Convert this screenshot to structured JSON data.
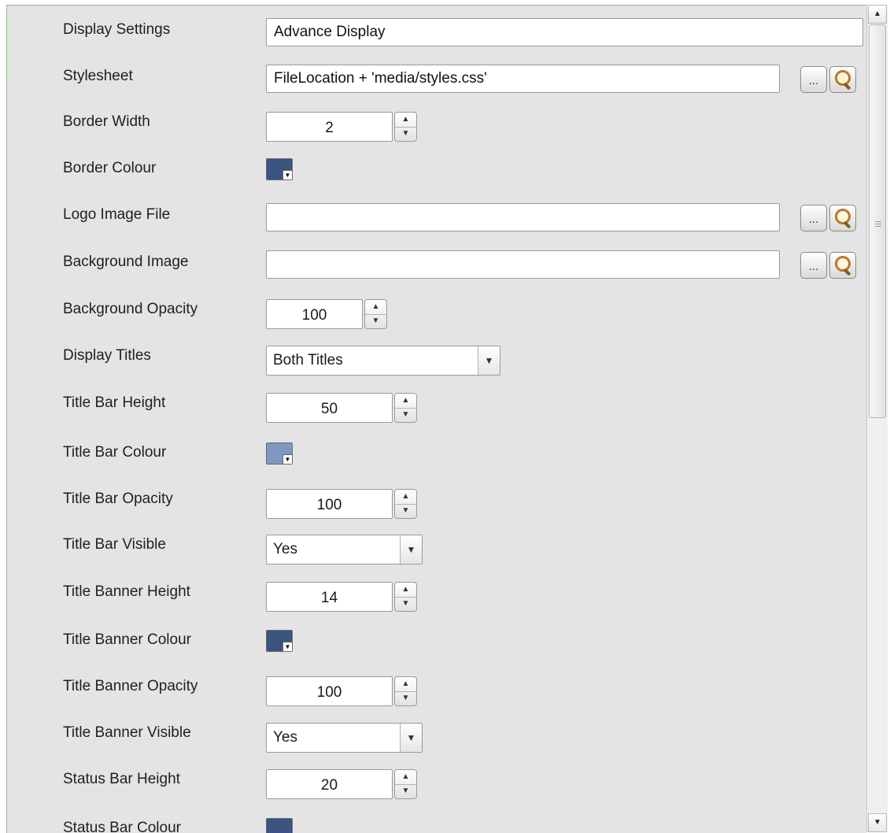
{
  "colors": {
    "panel_bg": "#e4e4e4",
    "border_colour": "#3b5380",
    "title_bar_colour": "#7e98c2",
    "title_banner_colour": "#3b5380",
    "status_bar_colour": "#3b5380"
  },
  "fields": {
    "display_settings": {
      "label": "Display Settings",
      "value": "Advance Display"
    },
    "stylesheet": {
      "label": "Stylesheet",
      "value": "FileLocation + 'media/styles.css'",
      "browse_label": "...",
      "search_icon": "magnifier-icon"
    },
    "border_width": {
      "label": "Border Width",
      "value": "2"
    },
    "border_colour": {
      "label": "Border Colour"
    },
    "logo_image_file": {
      "label": "Logo Image File",
      "value": "",
      "browse_label": "...",
      "search_icon": "magnifier-icon"
    },
    "background_image": {
      "label": "Background Image",
      "value": "",
      "browse_label": "...",
      "search_icon": "magnifier-icon"
    },
    "background_opacity": {
      "label": "Background Opacity",
      "value": "100"
    },
    "display_titles": {
      "label": "Display Titles",
      "value": "Both Titles"
    },
    "title_bar_height": {
      "label": "Title Bar Height",
      "value": "50"
    },
    "title_bar_colour": {
      "label": "Title Bar Colour"
    },
    "title_bar_opacity": {
      "label": "Title Bar Opacity",
      "value": "100"
    },
    "title_bar_visible": {
      "label": "Title Bar Visible",
      "value": "Yes"
    },
    "title_banner_height": {
      "label": "Title Banner Height",
      "value": "14"
    },
    "title_banner_colour": {
      "label": "Title Banner Colour"
    },
    "title_banner_opacity": {
      "label": "Title Banner Opacity",
      "value": "100"
    },
    "title_banner_visible": {
      "label": "Title Banner Visible",
      "value": "Yes"
    },
    "status_bar_height": {
      "label": "Status Bar Height",
      "value": "20"
    },
    "status_bar_colour": {
      "label": "Status Bar Colour"
    }
  },
  "glyphs": {
    "spin_up": "▲",
    "spin_down": "▼",
    "dropdown": "▼",
    "scroll_up": "▲",
    "scroll_down": "▼",
    "swatch_arrow": "▼"
  }
}
